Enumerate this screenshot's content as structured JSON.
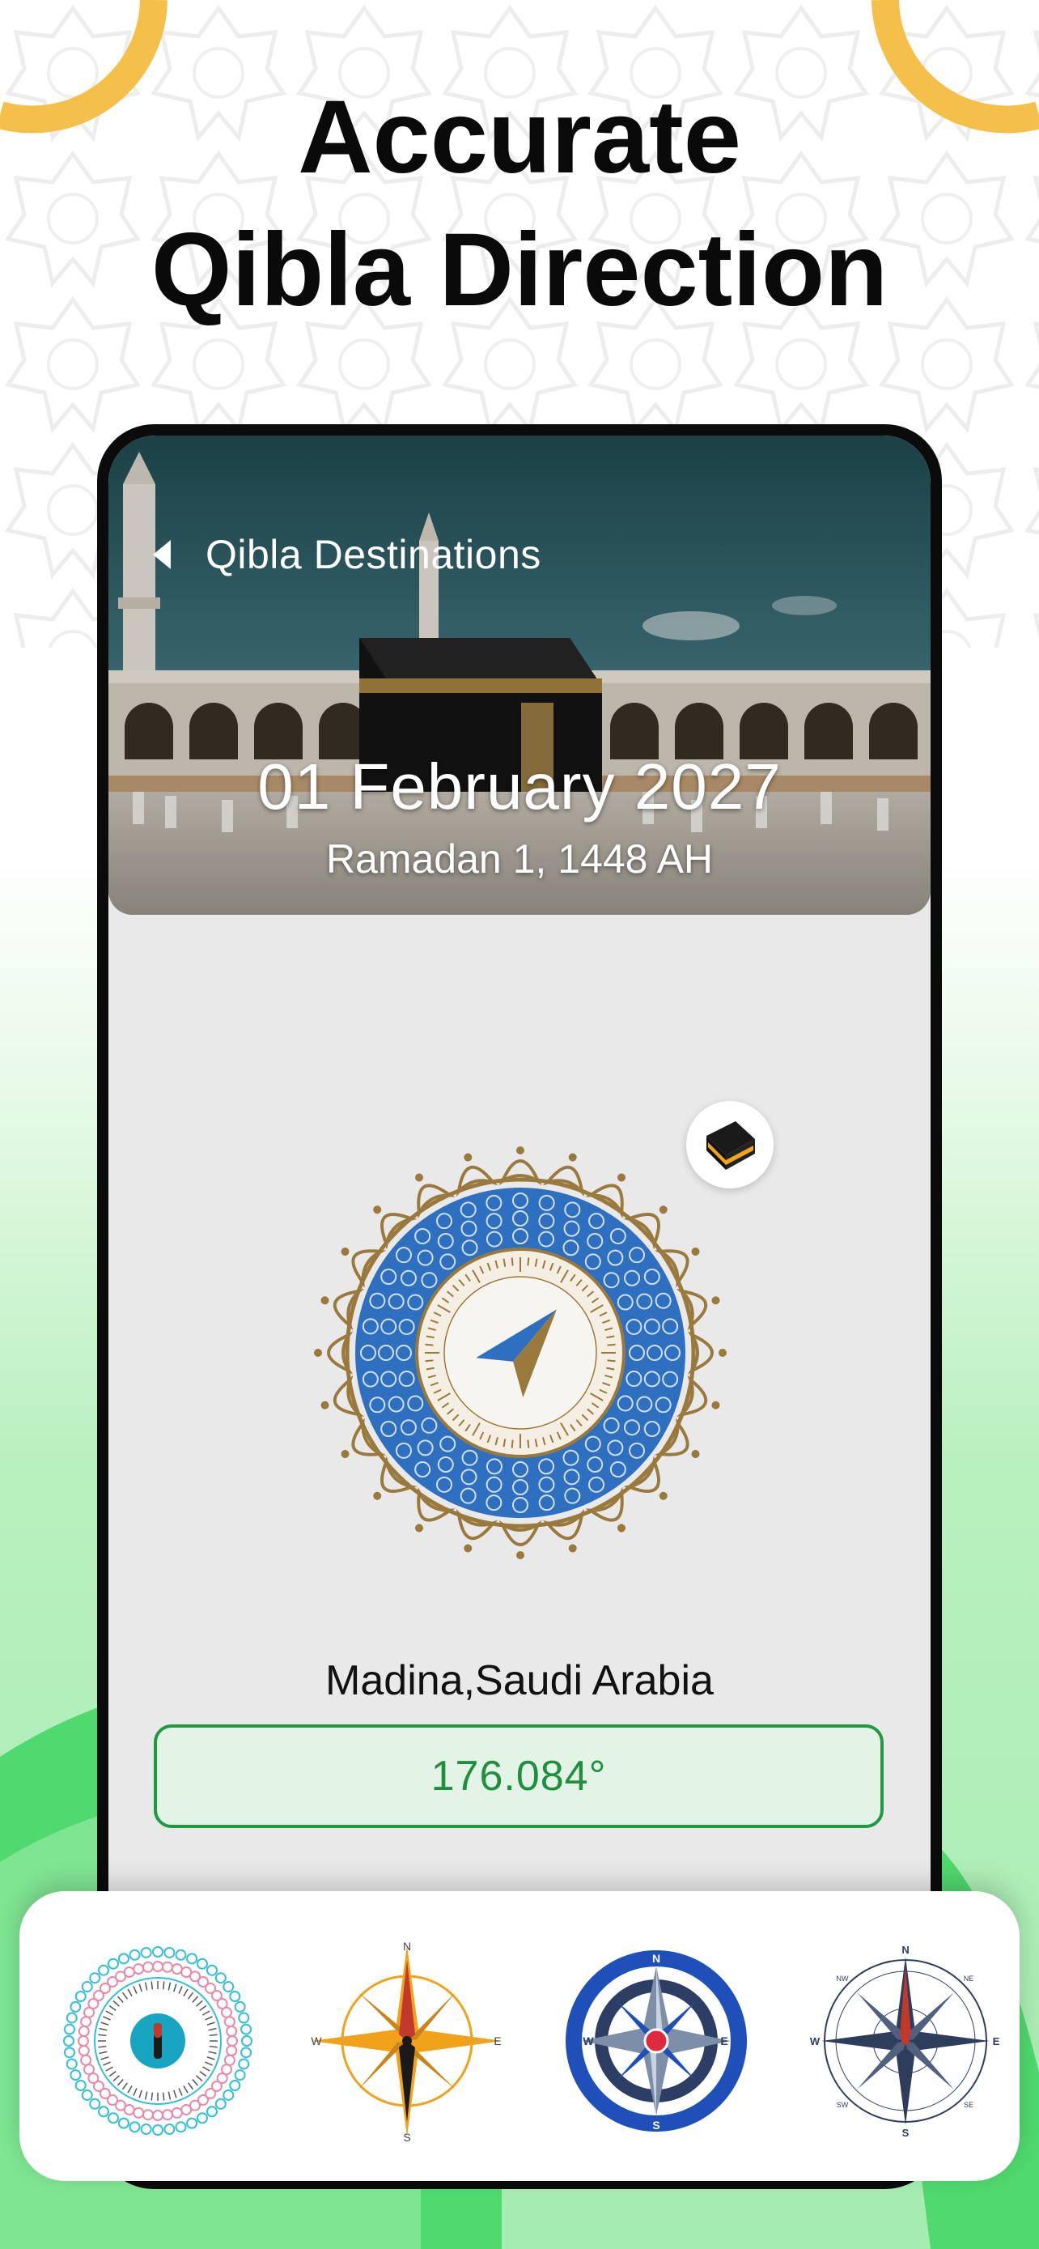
{
  "hero": {
    "line1": "Accurate",
    "line2": "Qibla Direction"
  },
  "app": {
    "screen_title": "Qibla Destinations",
    "date_gregorian": "01 February 2027",
    "date_hijri": "Ramadan 1, 1448 AH",
    "location": "Madina,Saudi Arabia",
    "qibla_degree": "176.084°"
  },
  "compass_styles": [
    {
      "name": "ornate-teal-pink",
      "selected": false
    },
    {
      "name": "gold-star",
      "labels": {
        "n": "N",
        "s": "S",
        "e": "E",
        "w": "W"
      }
    },
    {
      "name": "blue-ring",
      "labels": {
        "n": "N",
        "s": "S",
        "e": "E",
        "w": "W"
      }
    },
    {
      "name": "classic-navy",
      "labels": {
        "n": "N",
        "s": "S",
        "e": "E",
        "w": "W",
        "nw": "NW",
        "ne": "NE",
        "sw": "SW",
        "se": "SE"
      }
    }
  ],
  "colors": {
    "accent_green": "#1e9a43",
    "corner_arc": "#f5c04a",
    "compass_blue": "#2f6fbf",
    "compass_gold": "#9a7a3c"
  },
  "icons": [
    "back-arrow-icon",
    "kaaba-icon",
    "qibla-pointer-icon"
  ]
}
